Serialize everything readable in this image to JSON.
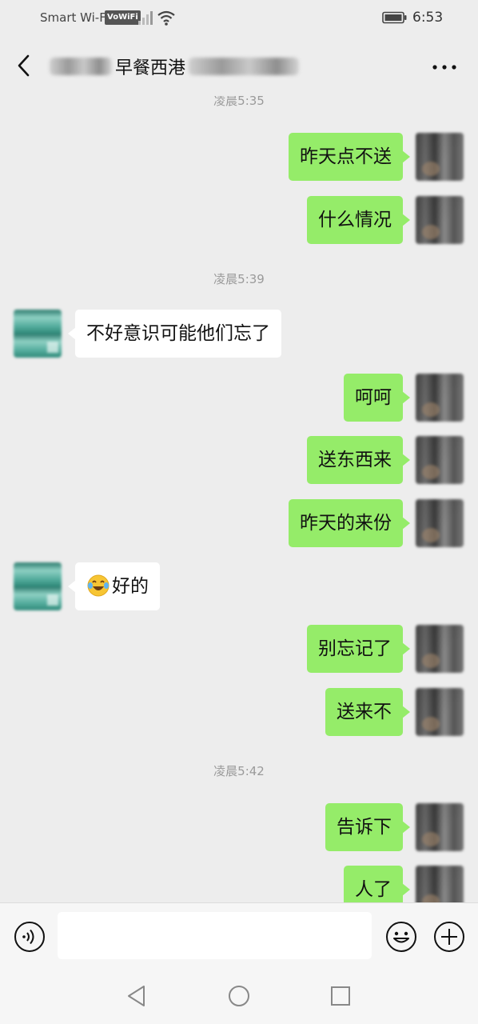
{
  "status_bar": {
    "carrier": "Smart Wi-Fi",
    "volte": "VoWiFi",
    "time": "6:53",
    "icons": [
      "signal-icon",
      "wifi-icon",
      "battery-icon"
    ]
  },
  "header": {
    "title_visible": "早餐西港",
    "back_icon": "back-arrow-icon",
    "more_icon": "more-dots-icon"
  },
  "timestamps": [
    "凌晨5:35",
    "凌晨5:39",
    "凌晨5:42"
  ],
  "messages": [
    {
      "side": "out",
      "text": "昨天点不送"
    },
    {
      "side": "out",
      "text": "什么情况"
    },
    {
      "side": "in",
      "text": "不好意识可能他们忘了"
    },
    {
      "side": "out",
      "text": "呵呵"
    },
    {
      "side": "out",
      "text": "送东西来"
    },
    {
      "side": "out",
      "text": "昨天的来份"
    },
    {
      "side": "in",
      "text": "好的",
      "emoji": "crying-laughing-emoji"
    },
    {
      "side": "out",
      "text": "别忘记了"
    },
    {
      "side": "out",
      "text": "送来不"
    },
    {
      "side": "out",
      "text": "告诉下"
    },
    {
      "side": "out",
      "text": "人了"
    }
  ],
  "input_bar": {
    "placeholder": "",
    "icons": [
      "voice-icon",
      "emoji-icon",
      "plus-icon"
    ]
  },
  "system_nav": {
    "icons": [
      "nav-back-icon",
      "nav-home-icon",
      "nav-recents-icon"
    ]
  },
  "colors": {
    "background": "#ededed",
    "outgoing_bubble": "#95ec69",
    "incoming_bubble": "#ffffff",
    "timestamp_text": "#9a9a9a"
  }
}
